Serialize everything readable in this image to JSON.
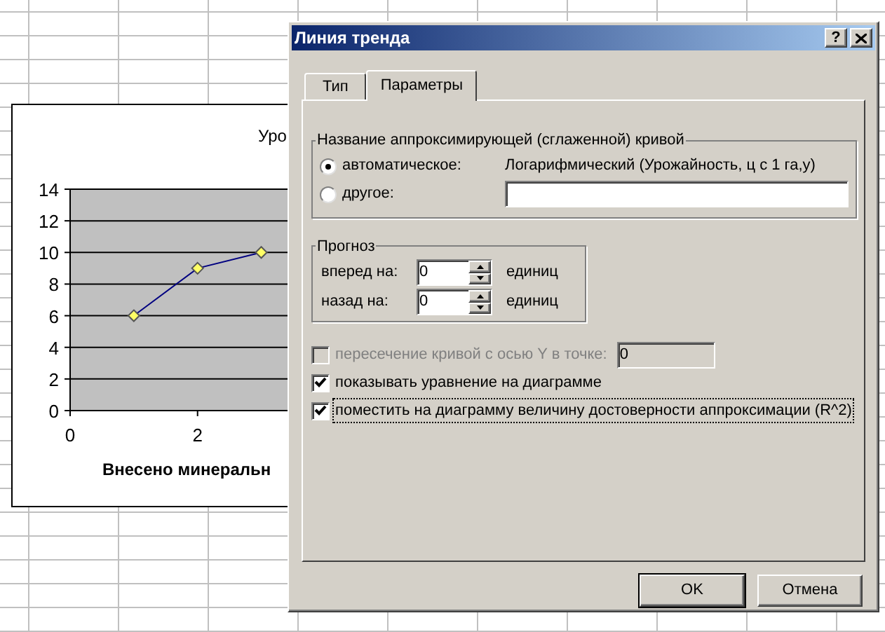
{
  "chart": {
    "title": "Уро",
    "chart_data": {
      "type": "line",
      "xlabel": "Внесено минеральн",
      "x": [
        1,
        2,
        3
      ],
      "series": [
        {
          "color": "#000080",
          "marker": "diamond",
          "values": [
            6,
            9,
            10
          ]
        }
      ],
      "xlim": [
        0,
        3.5
      ],
      "ylim": [
        0,
        14
      ],
      "grid": true,
      "xticks": [
        0,
        2
      ],
      "yticks": [
        0,
        2,
        4,
        6,
        8,
        10,
        12,
        14
      ]
    }
  },
  "window": {
    "title": "Линия тренда",
    "help_label": "?"
  },
  "tabs": [
    {
      "label": "Тип",
      "selected": false
    },
    {
      "label": "Параметры",
      "selected": true
    }
  ],
  "name_group": {
    "title": "Название аппроксимирующей (сглаженной) кривой",
    "options": [
      {
        "kind": "auto",
        "label": "автоматическое:",
        "value": "Логарифмический (Урожайность, ц с 1 га,у)",
        "selected": true
      },
      {
        "kind": "custom",
        "label": "другое:",
        "selected": false
      }
    ]
  },
  "forecast": {
    "title": "Прогноз",
    "rows": [
      {
        "label": "вперед на:",
        "value": "0",
        "unit": "единиц"
      },
      {
        "label": "назад на:",
        "value": "0",
        "unit": "единиц"
      }
    ]
  },
  "options": [
    {
      "label": "пересечение кривой с осью Y в точке:",
      "checked": false,
      "disabled": true,
      "value": "0",
      "focused": false
    },
    {
      "label": "показывать уравнение на диаграмме",
      "checked": true,
      "disabled": false,
      "focused": false
    },
    {
      "label": "поместить на диаграмму величину достоверности аппроксимации (R^2)",
      "checked": true,
      "disabled": false,
      "focused": true
    }
  ],
  "buttons": [
    {
      "label": "OK",
      "default": true
    },
    {
      "label": "Отмена",
      "default": false
    }
  ]
}
